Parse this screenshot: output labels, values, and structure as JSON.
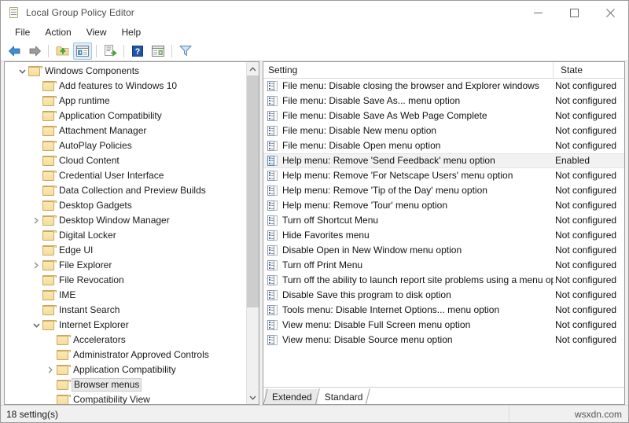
{
  "window": {
    "title": "Local Group Policy Editor",
    "icon": "policy-editor-icon",
    "minimize_label": "Minimize",
    "maximize_label": "Maximize",
    "close_label": "Close"
  },
  "menubar": {
    "items": [
      {
        "label": "File"
      },
      {
        "label": "Action"
      },
      {
        "label": "View"
      },
      {
        "label": "Help"
      }
    ]
  },
  "toolbar": {
    "buttons": [
      {
        "name": "back-button",
        "icon": "left-arrow-icon",
        "active": false
      },
      {
        "name": "forward-button",
        "icon": "right-arrow-icon",
        "active": false
      },
      {
        "name": "up-one-level-button",
        "icon": "folder-up-icon",
        "active": false
      },
      {
        "name": "show-hide-console-tree-button",
        "icon": "console-tree-icon",
        "active": true
      },
      {
        "name": "export-list-button",
        "icon": "export-list-icon",
        "active": false
      },
      {
        "name": "help-button",
        "icon": "question-mark-icon",
        "active": false
      },
      {
        "name": "show-action-pane-button",
        "icon": "action-pane-icon",
        "active": false
      },
      {
        "name": "filter-button",
        "icon": "funnel-filter-icon",
        "active": false
      }
    ]
  },
  "tree": {
    "nodes": [
      {
        "label": "Windows Components",
        "indent": 1,
        "twist": "expanded",
        "selected": false
      },
      {
        "label": "Add features to Windows 10",
        "indent": 2,
        "twist": "none",
        "selected": false
      },
      {
        "label": "App runtime",
        "indent": 2,
        "twist": "none",
        "selected": false
      },
      {
        "label": "Application Compatibility",
        "indent": 2,
        "twist": "none",
        "selected": false
      },
      {
        "label": "Attachment Manager",
        "indent": 2,
        "twist": "none",
        "selected": false
      },
      {
        "label": "AutoPlay Policies",
        "indent": 2,
        "twist": "none",
        "selected": false
      },
      {
        "label": "Cloud Content",
        "indent": 2,
        "twist": "none",
        "selected": false
      },
      {
        "label": "Credential User Interface",
        "indent": 2,
        "twist": "none",
        "selected": false
      },
      {
        "label": "Data Collection and Preview Builds",
        "indent": 2,
        "twist": "none",
        "selected": false
      },
      {
        "label": "Desktop Gadgets",
        "indent": 2,
        "twist": "none",
        "selected": false
      },
      {
        "label": "Desktop Window Manager",
        "indent": 2,
        "twist": "collapsed",
        "selected": false
      },
      {
        "label": "Digital Locker",
        "indent": 2,
        "twist": "none",
        "selected": false
      },
      {
        "label": "Edge UI",
        "indent": 2,
        "twist": "none",
        "selected": false
      },
      {
        "label": "File Explorer",
        "indent": 2,
        "twist": "collapsed",
        "selected": false
      },
      {
        "label": "File Revocation",
        "indent": 2,
        "twist": "none",
        "selected": false
      },
      {
        "label": "IME",
        "indent": 2,
        "twist": "none",
        "selected": false
      },
      {
        "label": "Instant Search",
        "indent": 2,
        "twist": "none",
        "selected": false
      },
      {
        "label": "Internet Explorer",
        "indent": 2,
        "twist": "expanded",
        "selected": false
      },
      {
        "label": "Accelerators",
        "indent": 3,
        "twist": "none",
        "selected": false
      },
      {
        "label": "Administrator Approved Controls",
        "indent": 3,
        "twist": "none",
        "selected": false
      },
      {
        "label": "Application Compatibility",
        "indent": 3,
        "twist": "collapsed",
        "selected": false
      },
      {
        "label": "Browser menus",
        "indent": 3,
        "twist": "none",
        "selected": true
      },
      {
        "label": "Compatibility View",
        "indent": 3,
        "twist": "none",
        "selected": false
      }
    ]
  },
  "list": {
    "columns": {
      "setting": "Setting",
      "state": "State"
    },
    "rows": [
      {
        "setting": "File menu: Disable closing the browser and Explorer windows",
        "state": "Not configured",
        "selected": false
      },
      {
        "setting": "File menu: Disable Save As... menu option",
        "state": "Not configured",
        "selected": false
      },
      {
        "setting": "File menu: Disable Save As Web Page Complete",
        "state": "Not configured",
        "selected": false
      },
      {
        "setting": "File menu: Disable New menu option",
        "state": "Not configured",
        "selected": false
      },
      {
        "setting": "File menu: Disable Open menu option",
        "state": "Not configured",
        "selected": false
      },
      {
        "setting": "Help menu: Remove 'Send Feedback' menu option",
        "state": "Enabled",
        "selected": true
      },
      {
        "setting": "Help menu: Remove 'For Netscape Users' menu option",
        "state": "Not configured",
        "selected": false
      },
      {
        "setting": "Help menu: Remove 'Tip of the Day' menu option",
        "state": "Not configured",
        "selected": false
      },
      {
        "setting": "Help menu: Remove 'Tour' menu option",
        "state": "Not configured",
        "selected": false
      },
      {
        "setting": "Turn off Shortcut Menu",
        "state": "Not configured",
        "selected": false
      },
      {
        "setting": "Hide Favorites menu",
        "state": "Not configured",
        "selected": false
      },
      {
        "setting": "Disable Open in New Window menu option",
        "state": "Not configured",
        "selected": false
      },
      {
        "setting": "Turn off Print Menu",
        "state": "Not configured",
        "selected": false
      },
      {
        "setting": "Turn off the ability to launch report site problems using a menu option",
        "state": "Not configured",
        "selected": false
      },
      {
        "setting": "Disable Save this program to disk option",
        "state": "Not configured",
        "selected": false
      },
      {
        "setting": "Tools menu: Disable Internet Options... menu option",
        "state": "Not configured",
        "selected": false
      },
      {
        "setting": "View menu: Disable Full Screen menu option",
        "state": "Not configured",
        "selected": false
      },
      {
        "setting": "View menu: Disable Source menu option",
        "state": "Not configured",
        "selected": false
      }
    ]
  },
  "tabs": [
    {
      "label": "Extended",
      "selected": true
    },
    {
      "label": "Standard",
      "selected": false
    }
  ],
  "statusbar": {
    "count_text": "18 setting(s)",
    "watermark": "wsxdn.com"
  },
  "colors": {
    "accent": "#dcecfb",
    "accent_border": "#9fc9ea",
    "folder": "#f3dc9c",
    "selection": "#f2f2f2",
    "window_bg": "#f0f0f0"
  }
}
